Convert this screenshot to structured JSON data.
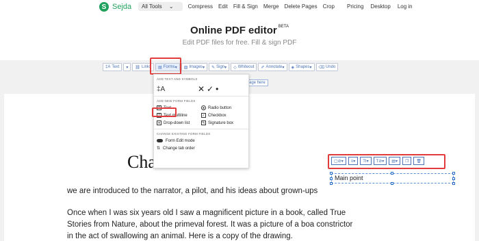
{
  "nav": {
    "logo_mark": "S",
    "logo_text": "Sejda",
    "all_tools": "All Tools",
    "links": [
      "Compress",
      "Edit",
      "Fill & Sign",
      "Merge",
      "Delete Pages",
      "Crop"
    ],
    "right_links": [
      "Pricing",
      "Desktop",
      "Log in"
    ]
  },
  "hero": {
    "title": "Online PDF editor",
    "beta": "BETA",
    "subtitle": "Edit PDF files for free. Fill & sign PDF"
  },
  "toolbar": {
    "text": "Text",
    "links": "Links",
    "forms": "Forms",
    "images": "Images",
    "sign": "Sign",
    "whiteout": "Whiteout",
    "annotate": "Annotate",
    "shapes": "Shapes",
    "undo": "Undo"
  },
  "insert_page": "Insert page here",
  "forms_menu": {
    "head_symbols": "ADD TEXT AND SYMBOLS",
    "symbol_text": "‡A",
    "symbol_marks": "✕✓•",
    "head_fields": "ADD NEW FORM FIELDS",
    "fields": [
      [
        "Text",
        "Radio button"
      ],
      [
        "Text multiline",
        "Checkbox"
      ],
      [
        "Drop-down list",
        "Signature box"
      ]
    ],
    "head_change": "CHANGE EXISTING FORM FIELDS",
    "edit_mode": "Form Edit mode",
    "tab_order": "Change tab order"
  },
  "document": {
    "chapter_fragment": "Cha",
    "line1": "we are introduced to the narrator, a pilot, and his ideas about grown-ups",
    "para2": [
      "Once when I was six years old I saw a magnificent picture in a book, called True",
      "Stories from Nature, about the primeval forest. It was a picture of a boa constrictor",
      "in the act of swallowing an animal. Here is a copy of the drawing."
    ]
  },
  "textbox": {
    "value": "Main point"
  }
}
